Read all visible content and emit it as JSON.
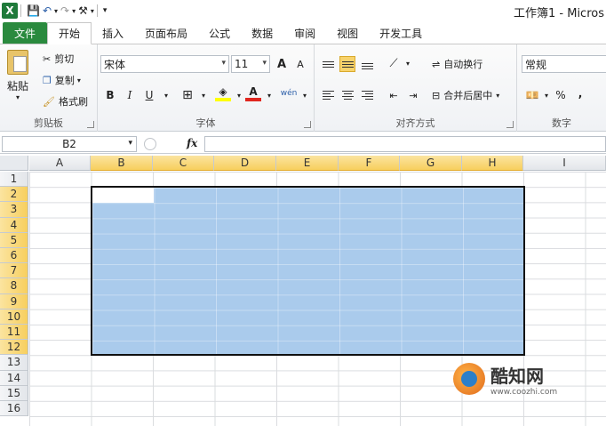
{
  "window": {
    "title": "工作簿1 - Micros"
  },
  "tabs": {
    "file": "文件",
    "items": [
      "开始",
      "插入",
      "页面布局",
      "公式",
      "数据",
      "审阅",
      "视图",
      "开发工具"
    ]
  },
  "ribbon": {
    "clipboard": {
      "paste": "粘贴",
      "cut": "剪切",
      "copy": "复制",
      "format_painter": "格式刷",
      "label": "剪贴板"
    },
    "font": {
      "name": "宋体",
      "size": "11",
      "bold": "B",
      "italic": "I",
      "underline": "U",
      "label": "字体",
      "grow": "A",
      "shrink": "A",
      "font_color": "A",
      "phonetic": "wén"
    },
    "alignment": {
      "wrap": "自动换行",
      "merge": "合并后居中",
      "label": "对齐方式"
    },
    "number": {
      "format": "常规",
      "percent": "%",
      "comma": ",",
      "label": "数字"
    }
  },
  "formula_bar": {
    "name_box": "B2",
    "fx": "fx",
    "value": ""
  },
  "grid": {
    "columns": [
      "A",
      "B",
      "C",
      "D",
      "E",
      "F",
      "G",
      "H",
      "I"
    ],
    "rows": [
      "1",
      "2",
      "3",
      "4",
      "5",
      "6",
      "7",
      "8",
      "9",
      "10",
      "11",
      "12",
      "13",
      "14",
      "15",
      "16"
    ],
    "selected_range": "B2:H12"
  },
  "watermark": {
    "title": "酷知网",
    "url": "www.coozhi.com"
  }
}
